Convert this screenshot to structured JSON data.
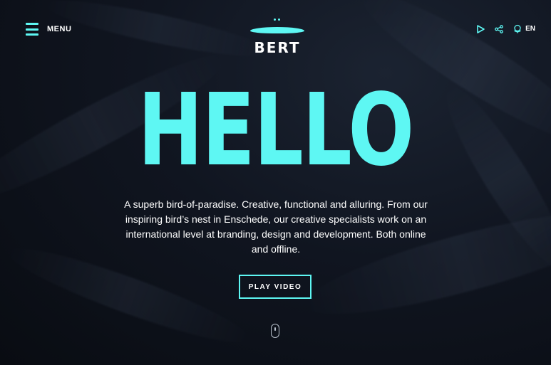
{
  "header": {
    "menu_label": "MENU",
    "logo_text": "BERT",
    "language": "EN",
    "icons": [
      "menu-icon",
      "play-icon",
      "share-icon",
      "globe-icon"
    ]
  },
  "hero": {
    "title": "HELLO",
    "description": "A superb bird-of-paradise. Creative, functional and alluring. From our inspiring bird’s nest in Enschede, our creative specialists work on an international level at branding, design and development. Both online and offline.",
    "cta_label": "PLAY VIDEO"
  },
  "colors": {
    "accent": "#5ef7f3",
    "background": "#0f141d",
    "text": "#ffffff"
  }
}
